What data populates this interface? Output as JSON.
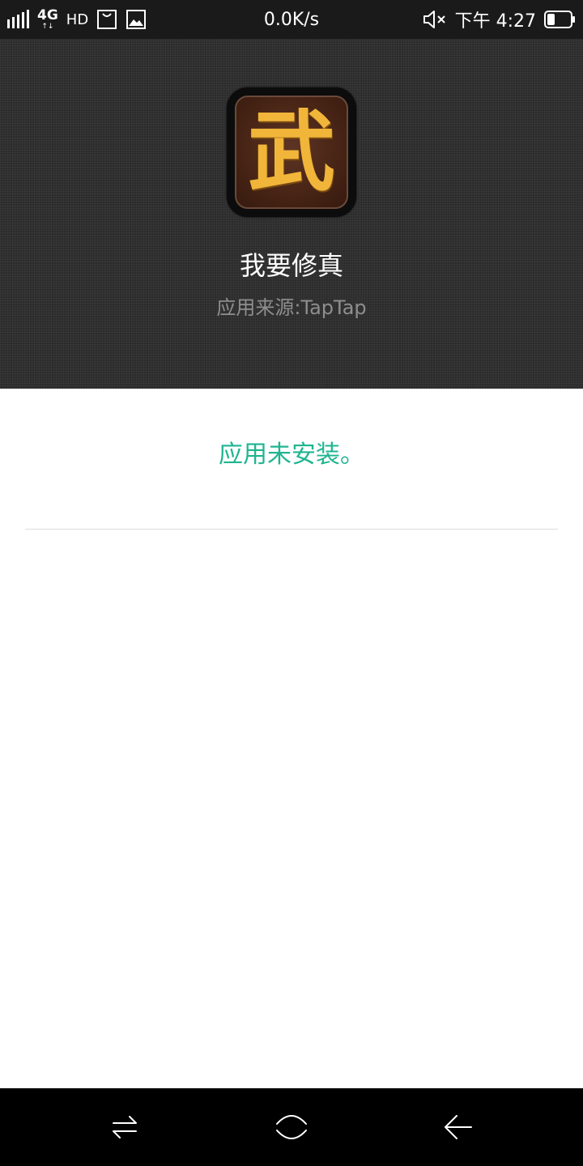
{
  "status_bar": {
    "network": "4G",
    "hd": "HD",
    "speed": "0.0K/s",
    "time": "下午 4:27"
  },
  "app": {
    "icon_glyph": "武",
    "name": "我要修真",
    "source": "应用来源:TapTap"
  },
  "result": {
    "message": "应用未安装。"
  },
  "colors": {
    "accent": "#1fb591",
    "header_bg": "#2c2c2c",
    "status_bar_bg": "#1a1a1a",
    "nav_bar_bg": "#000000",
    "icon_glyph": "#f1b53a"
  },
  "icons": {
    "status_left": [
      "signal-bars-icon",
      "network-4g-icon",
      "hd-icon",
      "shopping-bag-icon",
      "image-icon"
    ],
    "status_right": [
      "mute-icon",
      "battery-icon"
    ],
    "nav": [
      "switch-icon",
      "home-icon",
      "back-icon"
    ]
  }
}
